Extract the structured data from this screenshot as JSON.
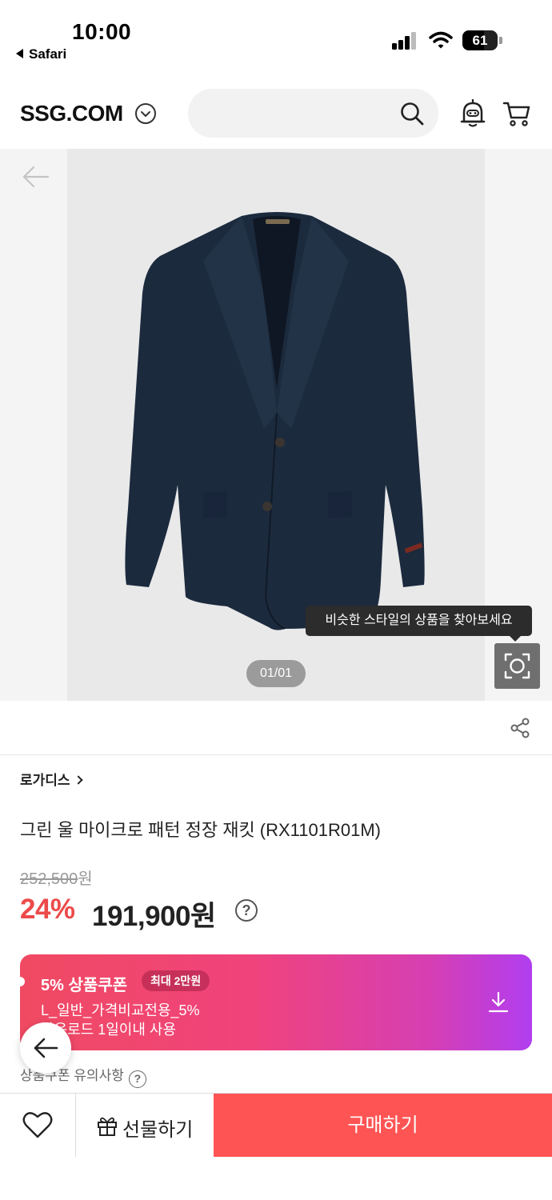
{
  "status_bar": {
    "time": "10:00",
    "back_app": "Safari",
    "battery": "61",
    "battery_level": 0.61
  },
  "header": {
    "logo": "SSG.COM",
    "search_placeholder": ""
  },
  "gallery": {
    "counter": "01/01",
    "tooltip": "비슷한 스타일의 상품을 찾아보세요"
  },
  "product": {
    "brand": "로가디스",
    "name": "그린 울 마이크로 패턴 정장 재킷 (RX1101R01M)",
    "original_price": "252,500",
    "original_unit": "원",
    "discount": "24%",
    "sale_price": "191,900원",
    "help_glyph": "?"
  },
  "coupon": {
    "title": "5% 상품쿠폰",
    "badge": "최대 2만원",
    "line1": "L_일반_가격비교전용_5%",
    "line2": "다운로드 1일이내 사용"
  },
  "coupon_notice": {
    "label": "상품쿠폰 유의사항",
    "help_glyph": "?"
  },
  "bottom_bar": {
    "gift_label": "선물하기",
    "buy_label": "구매하기"
  },
  "colors": {
    "accent_red": "#ff5454",
    "discount_red": "#ec4a4a",
    "coupon_start": "#f04a62",
    "coupon_end": "#b13ef0"
  }
}
